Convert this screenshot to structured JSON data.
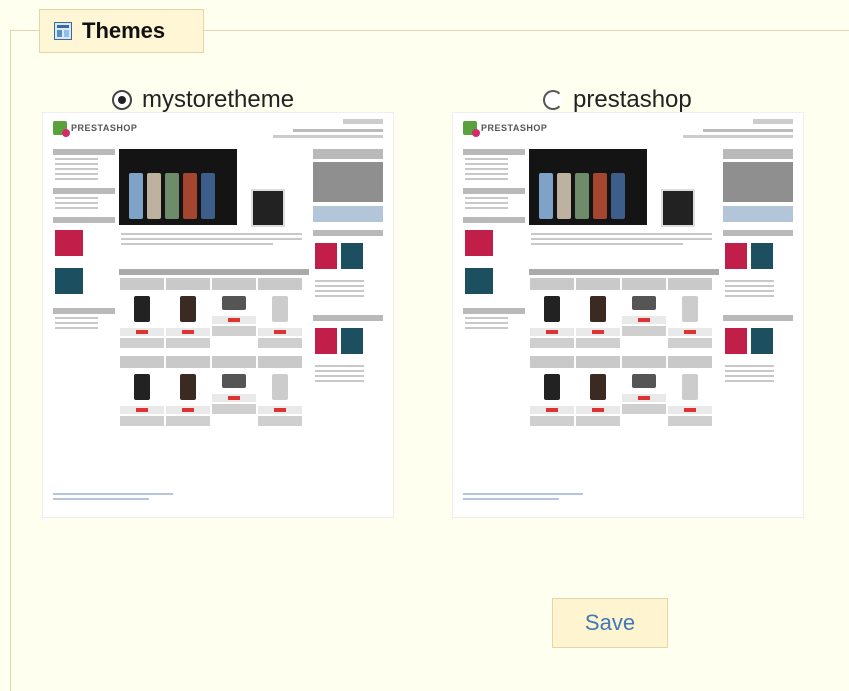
{
  "legend": {
    "title": "Themes",
    "icon": "theme-icon"
  },
  "themes": [
    {
      "name": "mystoretheme",
      "selected": true,
      "preview_logo": "PRESTASHOP"
    },
    {
      "name": "prestashop",
      "selected": false,
      "preview_logo": "PRESTASHOP"
    }
  ],
  "save_label": "Save",
  "colors": {
    "accent": "#3f79b6",
    "panel": "#fffff0",
    "legend_bg": "#fff6d6",
    "preview_green": "#5aa13c",
    "preview_pink": "#d22c6a"
  }
}
